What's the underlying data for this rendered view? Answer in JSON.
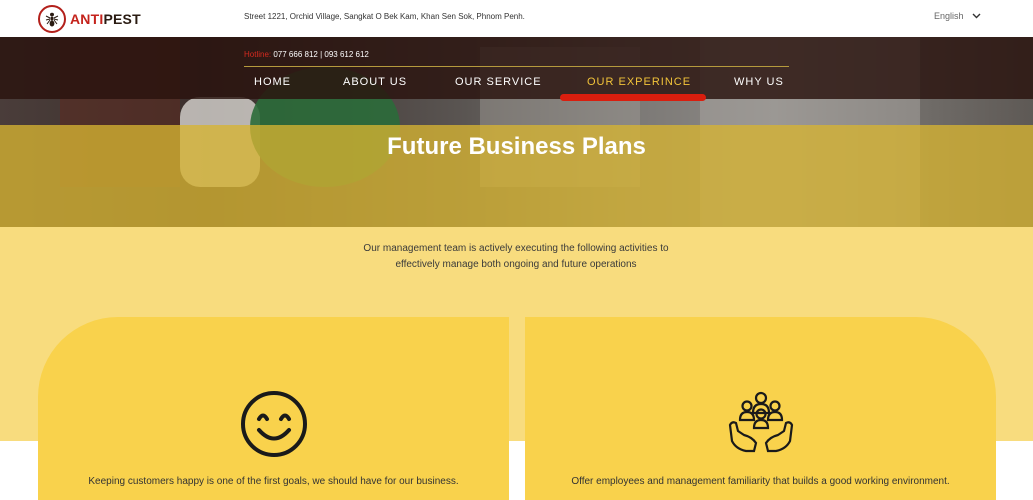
{
  "header": {
    "logo": {
      "part1": "ANTI",
      "part2": "PEST",
      "icon": "ant-shield-icon"
    },
    "address": "Street 1221, Orchid Village, Sangkat O Bek Kam, Khan Sen Sok, Phnom Penh.",
    "language": "English"
  },
  "hero": {
    "hotline_label": "Hotline:",
    "hotline_numbers": "077 666 812 | 093 612 612",
    "nav": [
      {
        "label": "HOME"
      },
      {
        "label": "ABOUT US"
      },
      {
        "label": "OUR SERVICE"
      },
      {
        "label": "OUR EXPERINCE",
        "active": true
      },
      {
        "label": "WHY US"
      }
    ],
    "title": "Future Business Plans"
  },
  "intro": {
    "line1": "Our management team is actively executing the following activities to",
    "line2": "effectively manage both ongoing and future operations"
  },
  "cards": [
    {
      "icon": "smiley-face-icon",
      "text": "Keeping customers happy is one of the first goals, we should have for our business."
    },
    {
      "icon": "team-hands-icon",
      "text": "Offer employees and management familiarity that builds a good working environment."
    }
  ],
  "colors": {
    "brand_red": "#c4231c",
    "nav_active": "#f2c43a",
    "overlay_yellow": "#d6b432",
    "card_yellow": "#f9d24c",
    "section_yellow": "#f8dc7e"
  }
}
